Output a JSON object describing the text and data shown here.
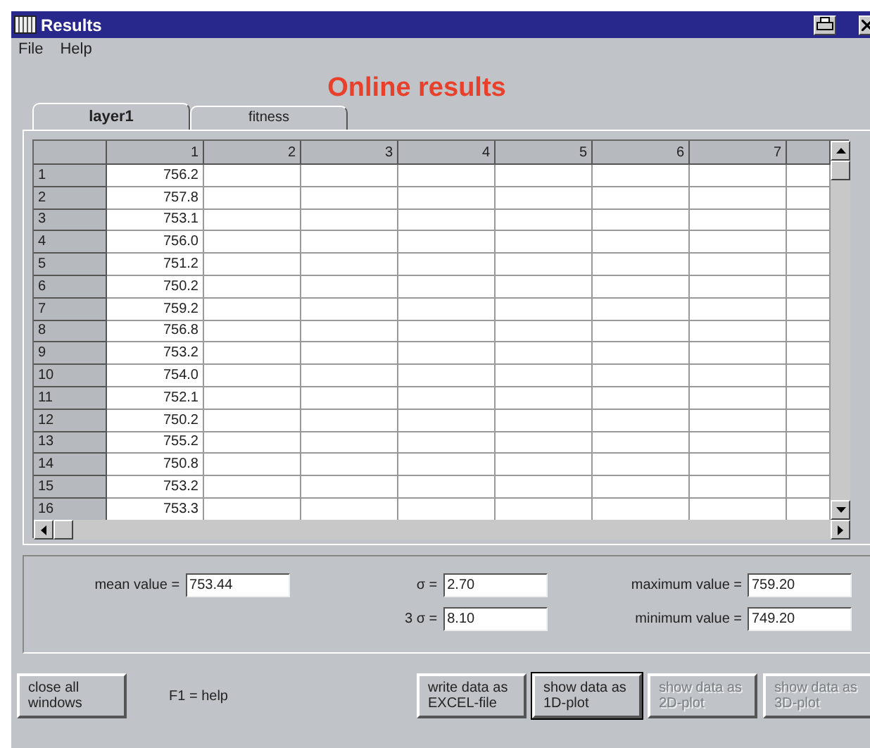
{
  "window": {
    "title": "Results"
  },
  "menu": [
    "File",
    "Help"
  ],
  "heading": "Online results",
  "tabs": [
    {
      "label": "layer1",
      "selected": true
    },
    {
      "label": "fitness",
      "selected": false
    }
  ],
  "table": {
    "columns": [
      "1",
      "2",
      "3",
      "4",
      "5",
      "6",
      "7"
    ],
    "rows": [
      {
        "label": "1",
        "values": [
          "756.2"
        ]
      },
      {
        "label": "2",
        "values": [
          "757.8"
        ]
      },
      {
        "label": "3",
        "values": [
          "753.1"
        ]
      },
      {
        "label": "4",
        "values": [
          "756.0"
        ]
      },
      {
        "label": "5",
        "values": [
          "751.2"
        ]
      },
      {
        "label": "6",
        "values": [
          "750.2"
        ]
      },
      {
        "label": "7",
        "values": [
          "759.2"
        ]
      },
      {
        "label": "8",
        "values": [
          "756.8"
        ]
      },
      {
        "label": "9",
        "values": [
          "753.2"
        ]
      },
      {
        "label": "10",
        "values": [
          "754.0"
        ]
      },
      {
        "label": "11",
        "values": [
          "752.1"
        ]
      },
      {
        "label": "12",
        "values": [
          "750.2"
        ]
      },
      {
        "label": "13",
        "values": [
          "755.2"
        ]
      },
      {
        "label": "14",
        "values": [
          "750.8"
        ]
      },
      {
        "label": "15",
        "values": [
          "753.2"
        ]
      },
      {
        "label": "16",
        "values": [
          "753.3"
        ]
      }
    ]
  },
  "stats": {
    "columns": [
      [
        {
          "label": "mean value =",
          "value": "753.44"
        }
      ],
      [
        {
          "label": "σ =",
          "value": "2.70"
        },
        {
          "label": "3 σ =",
          "value": "8.10"
        }
      ],
      [
        {
          "label": "maximum value =",
          "value": "759.20"
        },
        {
          "label": "minimum value =",
          "value": "749.20"
        }
      ]
    ]
  },
  "footer": {
    "left_button": {
      "label": "close all windows",
      "disabled": false,
      "default": false
    },
    "hint": "F1 = help",
    "buttons": [
      {
        "label": "write data as EXCEL-file",
        "disabled": false,
        "default": false
      },
      {
        "label": "show data as 1D-plot",
        "disabled": false,
        "default": true
      },
      {
        "label": "show data as 2D-plot",
        "disabled": true,
        "default": false
      },
      {
        "label": "show data as 3D-plot",
        "disabled": true,
        "default": false
      }
    ]
  }
}
